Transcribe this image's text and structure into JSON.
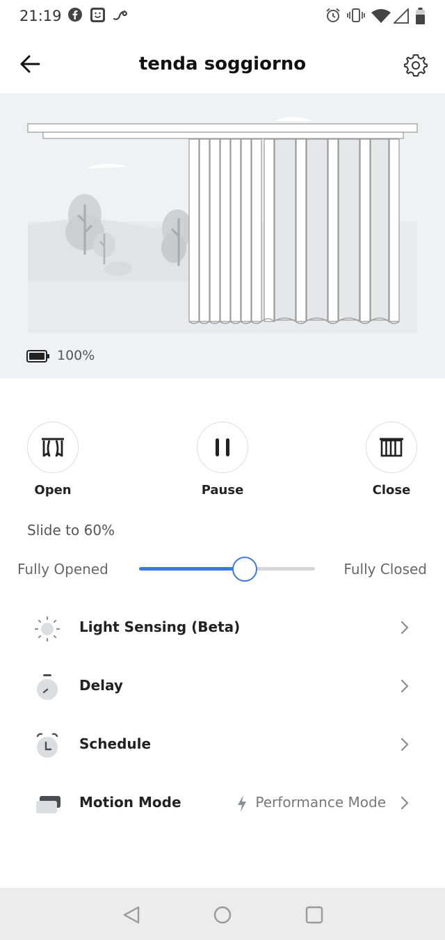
{
  "status_bar": {
    "time": "21:19",
    "left_icons": [
      "facebook-icon",
      "smile-app-icon",
      "swirl-app-icon"
    ],
    "right_icons": [
      "alarm-icon",
      "vibrate-icon",
      "wifi-icon",
      "signal-icon",
      "battery-icon"
    ]
  },
  "header": {
    "title": "tenda soggiorno",
    "back_icon": "arrow-left-icon",
    "settings_icon": "gear-icon"
  },
  "preview": {
    "battery_level": "100%",
    "battery_fraction": 1.0
  },
  "controls": {
    "open_label": "Open",
    "pause_label": "Pause",
    "close_label": "Close"
  },
  "slider": {
    "label": "Slide to 60%",
    "left_label": "Fully Opened",
    "right_label": "Fully Closed",
    "value_percent": 60,
    "accent": "#3b78e7"
  },
  "settings_list": {
    "light_sensing": "Light Sensing (Beta)",
    "delay": "Delay",
    "schedule": "Schedule",
    "motion_mode": "Motion Mode",
    "motion_mode_value": "Performance Mode"
  },
  "nav": {
    "icons": [
      "back-triangle-icon",
      "home-circle-icon",
      "recents-square-icon"
    ]
  }
}
